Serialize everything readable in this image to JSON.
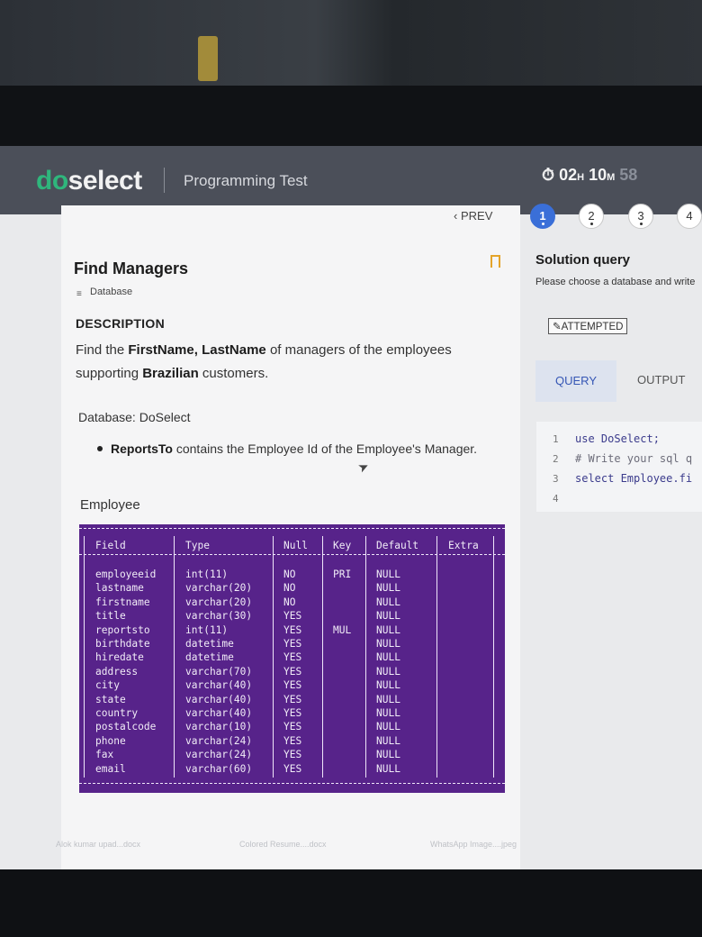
{
  "app": {
    "logo_prefix": "d",
    "logo_o": "o",
    "logo_suffix": "select",
    "test_title": "Programming Test"
  },
  "timer": {
    "icon": "stopwatch-icon",
    "hours": "02",
    "h_unit": "H",
    "minutes": "10",
    "m_unit": "M",
    "seconds": "58"
  },
  "nav": {
    "prev_label": "PREV",
    "questions": [
      "1",
      "2",
      "3",
      "4"
    ],
    "active_question": "1"
  },
  "question": {
    "title": "Find Managers",
    "category": "Database",
    "description_heading": "DESCRIPTION",
    "desc_part1": "Find the ",
    "desc_bold1": "FirstName, LastName",
    "desc_part2": " of managers of the employees supporting ",
    "desc_bold2": "Brazilian",
    "desc_part3": " customers.",
    "database_line": "Database: DoSelect",
    "bullet_bold": "ReportsTo",
    "bullet_text": " contains the Employee Id of the Employee's Manager.",
    "table_title": "Employee"
  },
  "schema_table": {
    "headers": [
      "Field",
      "Type",
      "Null",
      "Key",
      "Default",
      "Extra"
    ],
    "rows": [
      [
        "employeeid",
        "int(11)",
        "NO",
        "PRI",
        "NULL",
        ""
      ],
      [
        "lastname",
        "varchar(20)",
        "NO",
        "",
        "NULL",
        ""
      ],
      [
        "firstname",
        "varchar(20)",
        "NO",
        "",
        "NULL",
        ""
      ],
      [
        "title",
        "varchar(30)",
        "YES",
        "",
        "NULL",
        ""
      ],
      [
        "reportsto",
        "int(11)",
        "YES",
        "MUL",
        "NULL",
        ""
      ],
      [
        "birthdate",
        "datetime",
        "YES",
        "",
        "NULL",
        ""
      ],
      [
        "hiredate",
        "datetime",
        "YES",
        "",
        "NULL",
        ""
      ],
      [
        "address",
        "varchar(70)",
        "YES",
        "",
        "NULL",
        ""
      ],
      [
        "city",
        "varchar(40)",
        "YES",
        "",
        "NULL",
        ""
      ],
      [
        "state",
        "varchar(40)",
        "YES",
        "",
        "NULL",
        ""
      ],
      [
        "country",
        "varchar(40)",
        "YES",
        "",
        "NULL",
        ""
      ],
      [
        "postalcode",
        "varchar(10)",
        "YES",
        "",
        "NULL",
        ""
      ],
      [
        "phone",
        "varchar(24)",
        "YES",
        "",
        "NULL",
        ""
      ],
      [
        "fax",
        "varchar(24)",
        "YES",
        "",
        "NULL",
        ""
      ],
      [
        "email",
        "varchar(60)",
        "YES",
        "",
        "NULL",
        ""
      ]
    ]
  },
  "solution": {
    "title": "Solution query",
    "subtitle": "Please choose a database and write",
    "status": "ATTEMPTED",
    "tabs": [
      "QUERY",
      "OUTPUT"
    ],
    "active_tab": "QUERY",
    "code_lines": [
      {
        "n": "1",
        "text": "use DoSelect;"
      },
      {
        "n": "2",
        "text": "# Write your sql q"
      },
      {
        "n": "3",
        "text": "select Employee.fi"
      },
      {
        "n": "4",
        "text": ""
      }
    ]
  },
  "downloads": [
    "Alok kumar upad...docx",
    "Colored Resume....docx",
    "WhatsApp Image....jpeg"
  ],
  "colors": {
    "brand_green": "#2fb67c",
    "terminal_purple": "#57238a",
    "accent_blue": "#3a6fd8",
    "bookmark_orange": "#e4a42a"
  }
}
